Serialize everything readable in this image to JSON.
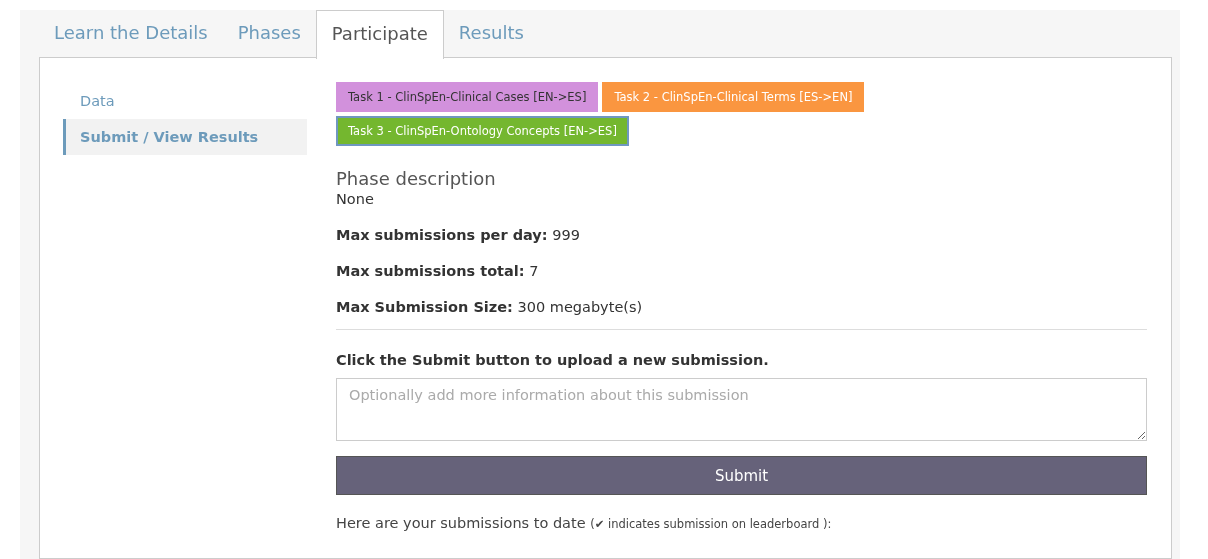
{
  "tabs": [
    {
      "label": "Learn the Details",
      "selected": false
    },
    {
      "label": "Phases",
      "selected": false
    },
    {
      "label": "Participate",
      "selected": true
    },
    {
      "label": "Results",
      "selected": false
    }
  ],
  "sidebar": {
    "items": [
      {
        "label": "Data",
        "selected": false
      },
      {
        "label": "Submit / View Results",
        "selected": true
      }
    ]
  },
  "phases": [
    {
      "label": "Task 1 - ClinSpEn-Clinical Cases [EN->ES]",
      "color": "#d291dc",
      "selected": false
    },
    {
      "label": "Task 2 - ClinSpEn-Clinical Terms [ES->EN]",
      "color": "#fa9640",
      "selected": false
    },
    {
      "label": "Task 3 - ClinSpEn-Ontology Concepts [EN->ES]",
      "color": "#74b72f",
      "selected": true
    }
  ],
  "phase_description": {
    "heading": "Phase description",
    "text": "None"
  },
  "limits": [
    {
      "label": "Max submissions per day:",
      "value": "999"
    },
    {
      "label": "Max submissions total:",
      "value": "7"
    },
    {
      "label": "Max Submission Size:",
      "value": "300 megabyte(s)"
    }
  ],
  "submit_form": {
    "prompt": "Click the Submit button to upload a new submission.",
    "placeholder": "Optionally add more information about this submission",
    "button": "Submit"
  },
  "submissions_note": {
    "text": "Here are your submissions to date",
    "note": "(✔ indicates submission on leaderboard ):"
  }
}
